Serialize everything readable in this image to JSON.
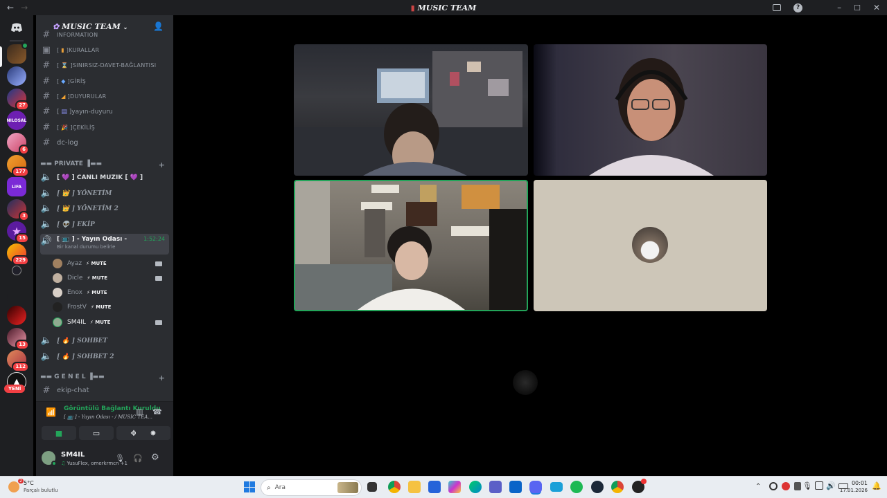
{
  "window": {
    "title": "MUSIC TEAM",
    "back": "←",
    "forward": "→",
    "min": "–",
    "max": "☐",
    "close": "✕",
    "help": "?"
  },
  "rail": {
    "badges": [
      "27",
      "6",
      "177",
      "3",
      "15",
      "229",
      "13",
      "112"
    ],
    "label_nilosal": "NILOSAL",
    "label_lifa": "LIFA",
    "new_label": "YENİ"
  },
  "guild": {
    "name": "MUSIC TEAM"
  },
  "channels_top": [
    {
      "name": "INFORMATION",
      "cut": true
    },
    {
      "prefix": "[",
      "name": "KURALLAR"
    },
    {
      "prefix": "[",
      "name": "SINIRSIZ-DAVET-BAĞLANTISI"
    },
    {
      "prefix": "[",
      "name": "GİRİŞ"
    },
    {
      "prefix": "[",
      "name": "DUYURULAR"
    },
    {
      "prefix": "[",
      "name": "yayın-duyuru"
    },
    {
      "prefix": "[",
      "name": "ÇEKİLİŞ"
    },
    {
      "name": "dc-log"
    }
  ],
  "private_category": "▬▬ PRIVATE ▐▬▬",
  "voice_channels": [
    {
      "name": "[ 💜 ] CANLI MUZIK [ 💜 ]"
    },
    {
      "name": "[ 👑 ] YÖNETİM"
    },
    {
      "name": "[ 👑 ] YÖNETİM 2"
    },
    {
      "name": "[ 👽 ] EKİP"
    }
  ],
  "active_channel": {
    "name": "[ 📺 ] - Yayın Odası -",
    "time": "1:52:24",
    "status": "Bir kanal durumu belirle"
  },
  "members": [
    {
      "name": "Ayaz",
      "tag": "⚡ MUTE",
      "cam": true
    },
    {
      "name": "Dicle",
      "tag": "⚡ MUTE",
      "cam": true
    },
    {
      "name": "Enox",
      "tag": "⚡ MUTE",
      "cam": false
    },
    {
      "name": "FrostV",
      "tag": "⚡ MUTE",
      "cam": false
    },
    {
      "name": "SM4IL",
      "tag": "⚡ MUTE",
      "cam": true
    }
  ],
  "voice_channels_2": [
    {
      "name": "[ 🔥 ] SOHBET"
    },
    {
      "name": "[ 🔥 ] SOHBET 2"
    }
  ],
  "genel_category": "▬▬ G E N E L ▐▬▬",
  "text_last": "ekip-chat",
  "voice_panel": {
    "status": "Görüntülü Bağlantı Kuruldu",
    "channel": "[ 📺 ] - Yayın Odası - / MUSIC TEA..."
  },
  "user": {
    "name": "SM4IL",
    "activity": "YusuFlex, omerkrmcn +1"
  },
  "taskbar": {
    "weather_temp": "5°C",
    "weather_desc": "Parçalı bulutlu",
    "search_placeholder": "Ara",
    "time": "00:01",
    "date": "17.01.2026",
    "weather_badge": "2"
  }
}
